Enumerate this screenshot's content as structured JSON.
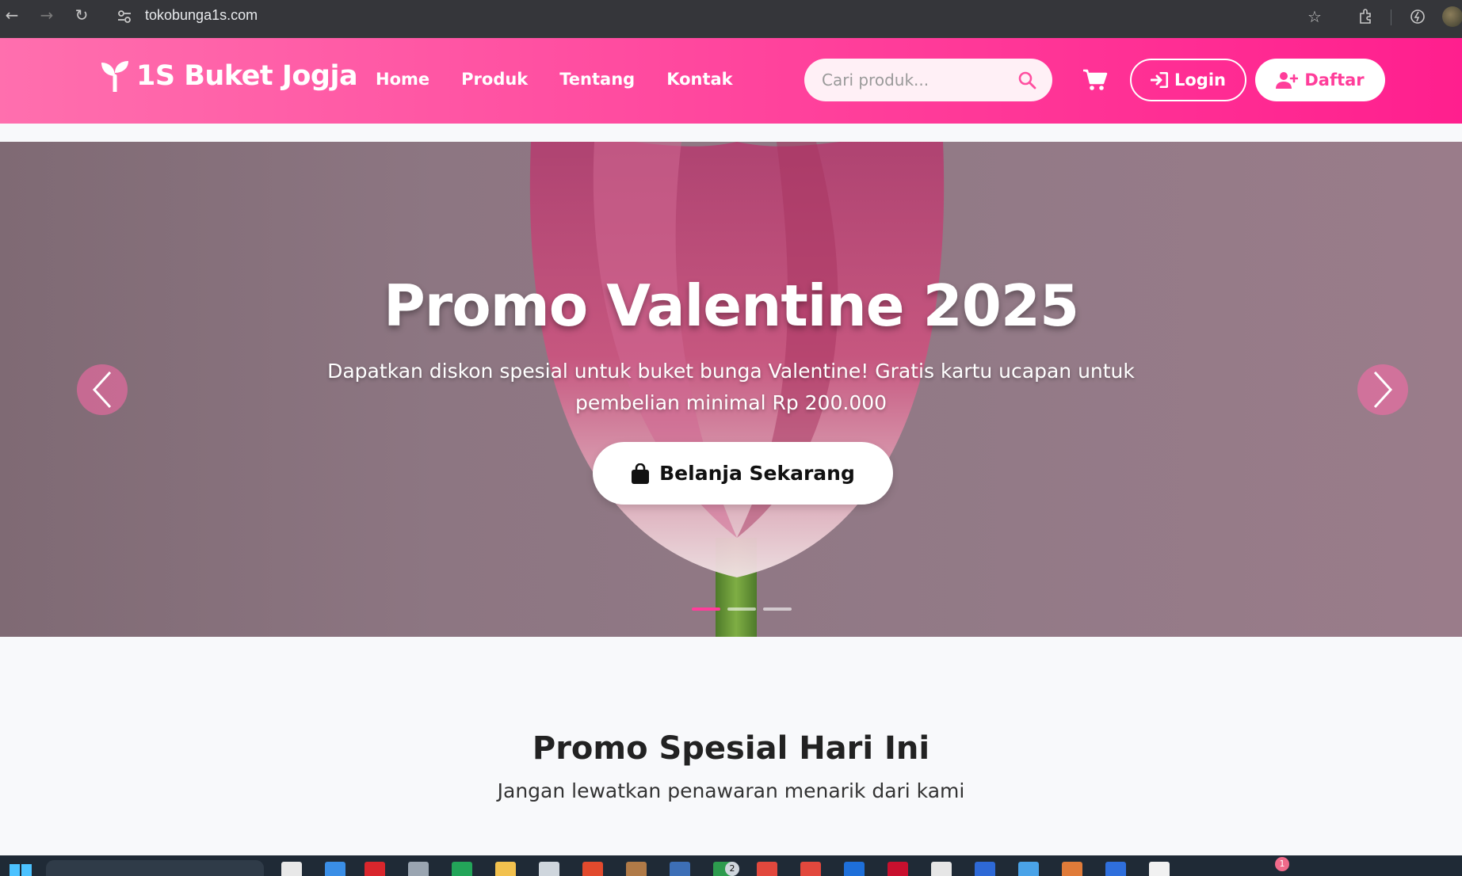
{
  "browser": {
    "url": "tokobunga1s.com"
  },
  "header": {
    "brand": "1S Buket Jogja",
    "nav": [
      "Home",
      "Produk",
      "Tentang",
      "Kontak"
    ],
    "search_placeholder": "Cari produk...",
    "login_label": "Login",
    "register_label": "Daftar"
  },
  "hero": {
    "title": "Promo Valentine 2025",
    "description": "Dapatkan diskon spesial untuk buket bunga Valentine! Gratis kartu ucapan untuk pembelian minimal Rp 200.000",
    "cta_label": "Belanja Sekarang",
    "slides_count": 3,
    "active_slide": 1
  },
  "promo": {
    "title": "Promo Spesial Hari Ini",
    "subtitle": "Jangan lewatkan penawaran menarik dari kami"
  },
  "colors": {
    "brand_pink": "#ff3d9a",
    "header_start": "#ff6fae",
    "header_end": "#ff1f8e",
    "browser_bar": "#35363a"
  },
  "taskbar": {
    "badges": [
      "2",
      "1"
    ]
  }
}
